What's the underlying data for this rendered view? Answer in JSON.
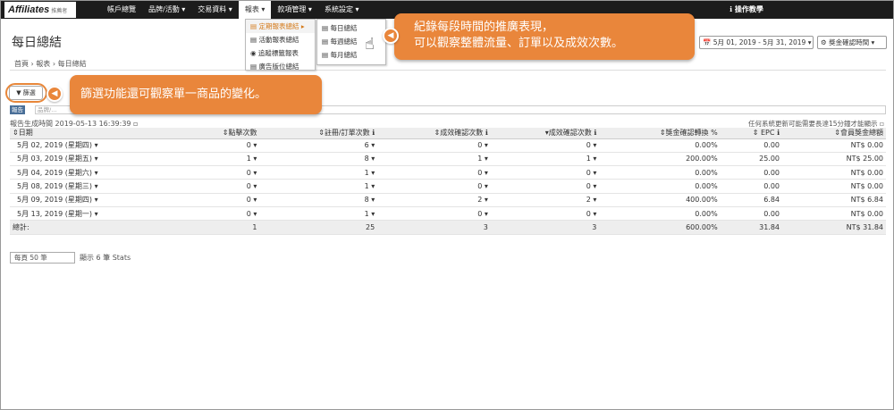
{
  "brand": {
    "logo": "Affiliates",
    "logo_sub": "推薦者"
  },
  "nav": {
    "items": [
      {
        "label": "帳戶總覽"
      },
      {
        "label": "品牌/活動 ▾"
      },
      {
        "label": "交易資料 ▾"
      },
      {
        "label": "報表 ▾"
      },
      {
        "label": "款項管理 ▾"
      },
      {
        "label": "系統設定 ▾"
      }
    ],
    "active_index": 3,
    "help": "ℹ 操作教學"
  },
  "page": {
    "title": "每日總結",
    "date_range": "📅 5月 01, 2019 - 5月 31, 2019 ▾",
    "period_button": "⚙ 獎金確認時間 ▾",
    "breadcrumb": "首頁 › 報表 › 每日總結"
  },
  "report_menu": {
    "items": [
      "▤ 定期報表總結 ▸",
      "▤ 活動報表總結",
      "◉ 追蹤標籤報表",
      "▤ 廣告版位總結"
    ]
  },
  "period_menu": {
    "items": [
      "▤ 每日總結",
      "▤ 每週總結",
      "▤ 每月總結"
    ]
  },
  "filter": {
    "label": "▼ 篩選",
    "tag": "報告",
    "tag_text": "品牌/..."
  },
  "report": {
    "generated": "報告生成時間 2019-05-13 16:39:39 ▫",
    "note": "任何系統更新可能需要長達15分鐘才能顯示 ▫",
    "columns": [
      "⇕日期",
      "⇕點擊次數",
      "⇕註冊/訂單次數 ℹ",
      "⇕成效確認次數 ℹ",
      "▾成效確認次數 ℹ",
      "⇕獎金確認轉換 %",
      "⇕ EPC ℹ",
      "⇕會員獎金總額"
    ],
    "rows": [
      [
        "5月 02, 2019 (星期四) ▾",
        "0 ▾",
        "6 ▾",
        "0 ▾",
        "0 ▾",
        "0.00%",
        "0.00",
        "NT$ 0.00"
      ],
      [
        "5月 03, 2019 (星期五) ▾",
        "1 ▾",
        "8 ▾",
        "1 ▾",
        "1 ▾",
        "200.00%",
        "25.00",
        "NT$ 25.00"
      ],
      [
        "5月 04, 2019 (星期六) ▾",
        "0 ▾",
        "1 ▾",
        "0 ▾",
        "0 ▾",
        "0.00%",
        "0.00",
        "NT$ 0.00"
      ],
      [
        "5月 08, 2019 (星期三) ▾",
        "0 ▾",
        "1 ▾",
        "0 ▾",
        "0 ▾",
        "0.00%",
        "0.00",
        "NT$ 0.00"
      ],
      [
        "5月 09, 2019 (星期四) ▾",
        "0 ▾",
        "8 ▾",
        "2 ▾",
        "2 ▾",
        "400.00%",
        "6.84",
        "NT$ 6.84"
      ],
      [
        "5月 13, 2019 (星期一) ▾",
        "0 ▾",
        "1 ▾",
        "0 ▾",
        "0 ▾",
        "0.00%",
        "0.00",
        "NT$ 0.00"
      ]
    ],
    "total": [
      "總計:",
      "1",
      "25",
      "3",
      "3",
      "600.00%",
      "31.84",
      "NT$ 31.84"
    ],
    "per_page": "每頁 50 筆",
    "stats_count": "顯示 6 筆 Stats"
  },
  "callouts": {
    "period_line1": "紀錄每段時間的推廣表現，",
    "period_line2": "可以觀察整體流量、訂單以及成效次數。",
    "filter": "篩選功能還可觀察單一商品的變化。"
  }
}
